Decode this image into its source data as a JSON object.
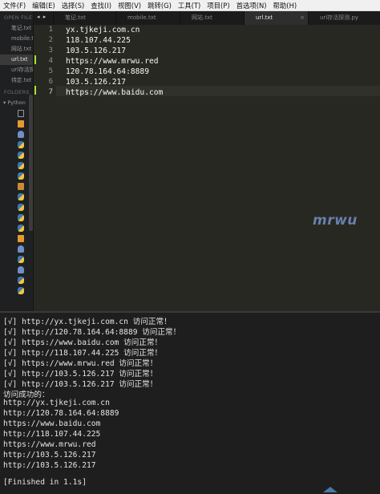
{
  "menu": [
    "文件(F)",
    "编辑(E)",
    "选择(S)",
    "查找(I)",
    "视图(V)",
    "跳转(G)",
    "工具(T)",
    "项目(P)",
    "首选项(N)",
    "帮助(H)"
  ],
  "sidebar": {
    "open_files_header": "OPEN FILES",
    "open_files": [
      "笔记.txt",
      "mobile.txt",
      "网站.txt",
      "url.txt",
      "url存活探测.py",
      "待定.txt"
    ],
    "folders_header": "FOLDERS",
    "folder_name": "Python",
    "tree_icons": [
      "blank-icon",
      "txt-file-icon",
      "elephant-icon",
      "python-file-icon",
      "python-file-icon",
      "python-file-icon",
      "python-file-icon",
      "image-file-icon",
      "python-file-icon",
      "python-file-icon",
      "python-file-icon",
      "python-file-icon",
      "txt-file-icon",
      "elephant-icon",
      "python-file-icon",
      "elephant-icon",
      "python-file-icon",
      "python-file-icon"
    ]
  },
  "tabs": {
    "nav": "◂ ▸",
    "items": [
      "笔记.txt",
      "mobile.txt",
      "网站.txt",
      "url.txt",
      "url存活探测.py"
    ],
    "active_index": 3,
    "close_glyph": "×"
  },
  "editor": {
    "line_numbers": [
      "1",
      "2",
      "3",
      "4",
      "5",
      "6",
      "7"
    ],
    "lines": [
      "yx.tjkeji.com.cn",
      "118.107.44.225",
      "103.5.126.217",
      "https://www.mrwu.red",
      "120.78.164.64:8889",
      "103.5.126.217",
      "https://www.baidu.com"
    ],
    "current_line": 7,
    "watermark": "mrwu"
  },
  "output": {
    "lines": [
      "[√] http://yx.tjkeji.com.cn 访问正常！",
      "[√] http://120.78.164.64:8889 访问正常！",
      "[√] https://www.baidu.com 访问正常！",
      "[√] http://118.107.44.225 访问正常！",
      "[√] https://www.mrwu.red 访问正常！",
      "[√] http://103.5.126.217 访问正常！",
      "[√] http://103.5.126.217 访问正常！",
      "访问成功的：",
      "http://yx.tjkeji.com.cn",
      "http://120.78.164.64:8889",
      "https://www.baidu.com",
      "http://118.107.44.225",
      "https://www.mrwu.red",
      "http://103.5.126.217",
      "http://103.5.126.217",
      "",
      "[Finished in 1.1s]"
    ]
  },
  "colors": {
    "editor_bg": "#272822",
    "sidebar_bg": "#1f2022",
    "output_bg": "#1e1e1e",
    "modified_marker": "#a6e22e",
    "watermark": "#6a7faa"
  }
}
